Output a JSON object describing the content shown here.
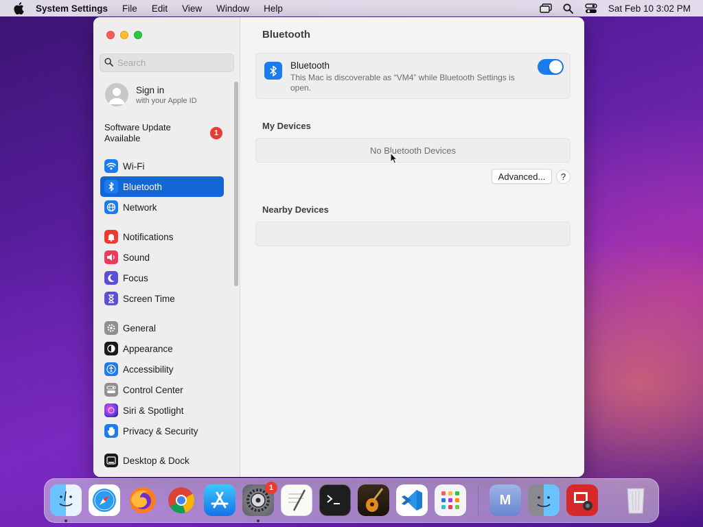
{
  "menubar": {
    "app_name": "System Settings",
    "menus": [
      "File",
      "Edit",
      "View",
      "Window",
      "Help"
    ],
    "clock": "Sat Feb 10  3:02 PM"
  },
  "sidebar": {
    "search_placeholder": "Search",
    "signin": {
      "title": "Sign in",
      "subtitle": "with your Apple ID"
    },
    "update": {
      "label": "Software Update Available",
      "badge": "1"
    },
    "items": [
      {
        "label": "Wi-Fi",
        "icon": "wifi-icon",
        "color": "#1d7bf0",
        "selected": false
      },
      {
        "label": "Bluetooth",
        "icon": "bluetooth-icon",
        "color": "#1d7bf0",
        "selected": true
      },
      {
        "label": "Network",
        "icon": "globe-icon",
        "color": "#1d7bf0",
        "selected": false
      },
      {
        "label": "Notifications",
        "icon": "bell-icon",
        "color": "#ea3b30",
        "selected": false
      },
      {
        "label": "Sound",
        "icon": "speaker-icon",
        "color": "#ea3b5c",
        "selected": false
      },
      {
        "label": "Focus",
        "icon": "moon-icon",
        "color": "#5b4fd6",
        "selected": false
      },
      {
        "label": "Screen Time",
        "icon": "hourglass-icon",
        "color": "#5b4fd6",
        "selected": false
      },
      {
        "label": "General",
        "icon": "gear-icon",
        "color": "#8e8e93",
        "selected": false
      },
      {
        "label": "Appearance",
        "icon": "appearance-icon",
        "color": "#1a1a1a",
        "selected": false
      },
      {
        "label": "Accessibility",
        "icon": "accessibility-icon",
        "color": "#1d7bf0",
        "selected": false
      },
      {
        "label": "Control Center",
        "icon": "control-center-icon",
        "color": "#8e8e93",
        "selected": false
      },
      {
        "label": "Siri & Spotlight",
        "icon": "siri-icon",
        "color": "#b03ad8",
        "selected": false
      },
      {
        "label": "Privacy & Security",
        "icon": "hand-icon",
        "color": "#1d7bf0",
        "selected": false
      },
      {
        "label": "Desktop & Dock",
        "icon": "dock-icon",
        "color": "#1a1a1a",
        "selected": false
      }
    ]
  },
  "content": {
    "title": "Bluetooth",
    "bluetooth_card": {
      "name": "Bluetooth",
      "description": "This Mac is discoverable as “VM4” while Bluetooth Settings is open.",
      "enabled": true
    },
    "my_devices": {
      "heading": "My Devices",
      "empty_text": "No Bluetooth Devices"
    },
    "advanced_button": "Advanced...",
    "help_button": "?",
    "nearby_devices": {
      "heading": "Nearby Devices"
    }
  },
  "dock": {
    "apps": [
      {
        "name": "Finder",
        "icon": "finder-icon"
      },
      {
        "name": "Safari",
        "icon": "safari-icon"
      },
      {
        "name": "Firefox",
        "icon": "firefox-icon"
      },
      {
        "name": "Chrome",
        "icon": "chrome-icon"
      },
      {
        "name": "App Store",
        "icon": "app-store-icon"
      },
      {
        "name": "System Settings",
        "icon": "system-settings-icon",
        "badge": "1"
      },
      {
        "name": "TextEdit",
        "icon": "textedit-icon"
      },
      {
        "name": "Terminal",
        "icon": "terminal-icon"
      },
      {
        "name": "GarageBand",
        "icon": "garageband-icon"
      },
      {
        "name": "VS Code",
        "icon": "vscode-icon"
      },
      {
        "name": "Launchpad",
        "icon": "launchpad-icon"
      },
      {
        "name": "M",
        "icon": "m-app-icon",
        "label": "M"
      },
      {
        "name": "Migration Assistant",
        "icon": "migration-icon"
      },
      {
        "name": "Photo Booth",
        "icon": "photo-booth-icon"
      },
      {
        "name": "Trash",
        "icon": "trash-icon"
      }
    ]
  }
}
